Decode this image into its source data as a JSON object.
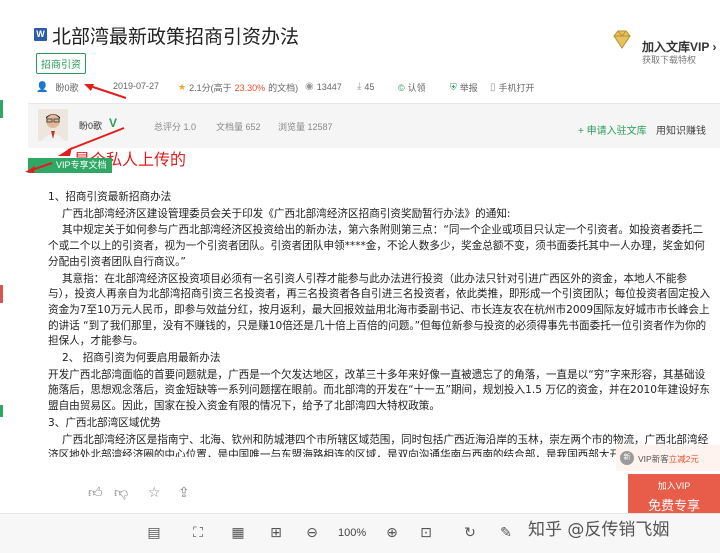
{
  "header": {
    "doc_icon": "W",
    "title": "北部湾最新政策招商引资办法",
    "tag": "招商引资",
    "vip": {
      "title": "加入文库VIP ›",
      "subtitle": "获取下载特权"
    }
  },
  "meta": {
    "uploader": "盼0歌",
    "date": "2019-07-27",
    "rating": "2.1分(高于",
    "rating_pct": "23.30%",
    "rating_suffix": "的文档)",
    "views": "13447",
    "downloads": "45",
    "certified": "认领",
    "report": "举报",
    "phone_open": "手机打开"
  },
  "uploader_panel": {
    "name": "盼0歌",
    "badge": "V",
    "score": "总评分 1.0",
    "doc_count": "文档量 652",
    "view_count": "浏览量 12587",
    "apply": "+ 申请入驻文库",
    "earn": "用知识赚钱"
  },
  "annotation": "是个私人上传的",
  "ribbon": "VIP专享文档",
  "body": {
    "h1": "1、招商引资最新招商办法",
    "p1": "广西北部湾经济区建设管理委员会关于印发《广西北部湾经济区招商引资奖励暂行办法》的通知:",
    "p2": "其中规定关于如何参与广西北部湾经济区投资给出的新办法，第六条附则第三点：“同一个企业或项目只认定一个引资者。如投资者委托二个或二个以上的引资者，视为一个引资者团队。引资者团队申领****金，不论人数多少，奖金总额不变，须书面委托其中一人办理，奖金如何分配由引资者团队自行商议。”",
    "p3": "其意指：在北部湾经济区投资项目必须有一名引资人引荐才能参与此办法进行投资（此办法只针对引进广西区外的资金，本地人不能参与），投资人再亲自为北部湾招商引资三名投资者，再三名投资者各自引进三名投资者，依此类推，即形成一个引资团队；每位投资者固定投入资金为7至10万元人民币，即参与效益分红，按月返利，最大回报效益用北海市委副书记、市长连友农在杭州市2009国际友好城市市长峰会上的讲话 “到了我们那里，没有不赚钱的，只是赚10倍还是几十倍上百倍的问题。”但每位新参与投资的必须得事先书面委托一位引资者作为你的担保人，才能参与。",
    "h2": "2、 招商引资为何要启用最新办法",
    "p4": "开发广西北部湾面临的首要问题就是，广西是一个欠发达地区，改革三十多年来好像一直被遗忘了的角落，一直是以“穷”字来形容，其基础设施落后，思想观念落后，资金短缺等一系列问题摆在眼前。而北部湾的开发在“十一五”期间，规划投入1.5 万亿的资金，并在2010年建设好东盟自由贸易区。因此，国家在投入资金有限的情况下，给予了北部湾四大特权政策。",
    "h3": "3、广西北部湾区域优势",
    "p5": "广西北部湾经济区是指南宁、北海、钦州和防城港四个市所辖区域范围，同时包括广西近海沿岸的玉林，崇左两个市的物流，广西北部湾经济区地处北部湾经济圈的中心位置，是中国唯一与东盟海路相连的区域，是双向沟通华南与西南的结合部，是我国西部大开发地区唯一"
  },
  "promo": {
    "badge": "新",
    "text": "VIP新客",
    "highlight": "立减2元",
    "join": "加入VIP",
    "free": "免费专享"
  },
  "toolbar": {
    "zoom": "100%"
  },
  "watermark": "知乎 @反传销飞姻"
}
